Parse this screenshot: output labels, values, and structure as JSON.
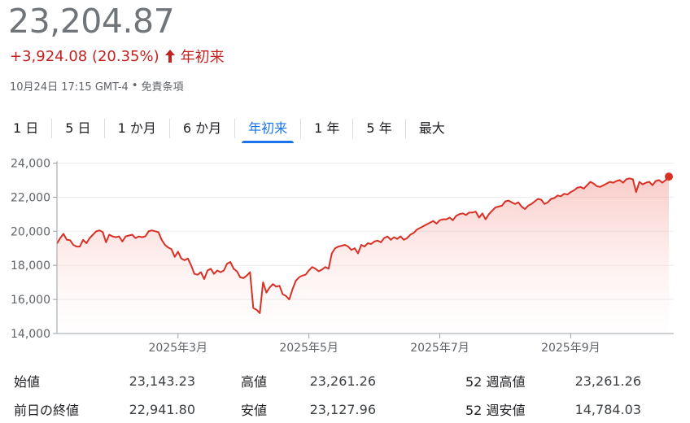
{
  "quote": {
    "price": "23,204.87",
    "change": "+3,924.08 (20.35%)",
    "period_label": "年初来",
    "timestamp": "10月24日 17:15 GMT-4",
    "disclaimer": "免責条項",
    "change_color": "#c5221f"
  },
  "tabs": [
    {
      "label": "1 日",
      "active": false
    },
    {
      "label": "5 日",
      "active": false
    },
    {
      "label": "1 か月",
      "active": false
    },
    {
      "label": "6 か月",
      "active": false
    },
    {
      "label": "年初来",
      "active": true
    },
    {
      "label": "1 年",
      "active": false
    },
    {
      "label": "5 年",
      "active": false
    },
    {
      "label": "最大",
      "active": false
    }
  ],
  "chart_data": {
    "type": "area",
    "x_tick_labels": [
      "2025年3月",
      "2025年5月",
      "2025年7月",
      "2025年9月"
    ],
    "x_tick_index": [
      37,
      77,
      117,
      157
    ],
    "y_ticks": [
      14000,
      16000,
      18000,
      20000,
      22000,
      24000
    ],
    "y_tick_labels": [
      "14,000",
      "16,000",
      "18,000",
      "20,000",
      "22,000",
      "24,000"
    ],
    "ylim": [
      14000,
      24500
    ],
    "grid": true,
    "line_color": "#d93025",
    "values": [
      19280,
      19600,
      19850,
      19500,
      19480,
      19200,
      19100,
      19100,
      19500,
      19300,
      19600,
      19800,
      20000,
      20050,
      19950,
      19350,
      19800,
      19700,
      19650,
      19700,
      19400,
      19700,
      19750,
      19800,
      19600,
      19700,
      19650,
      19700,
      20000,
      20050,
      20000,
      19950,
      19500,
      19200,
      19050,
      18950,
      18500,
      18800,
      18400,
      18300,
      18400,
      18000,
      17500,
      17450,
      17600,
      17200,
      17700,
      17800,
      17500,
      17700,
      17600,
      17700,
      18100,
      18200,
      17800,
      17650,
      17300,
      17250,
      17400,
      17600,
      15500,
      15400,
      15200,
      17000,
      16400,
      16700,
      16900,
      16750,
      16800,
      16300,
      16200,
      16000,
      16600,
      17100,
      17300,
      17400,
      17450,
      17700,
      17900,
      17800,
      17650,
      17750,
      17900,
      17800,
      18700,
      19000,
      19100,
      19150,
      19200,
      19100,
      18900,
      19000,
      18700,
      19200,
      19100,
      19300,
      19250,
      19400,
      19450,
      19350,
      19600,
      19700,
      19500,
      19650,
      19550,
      19700,
      19500,
      19600,
      19800,
      19900,
      20100,
      20200,
      20300,
      20400,
      20500,
      20600,
      20450,
      20650,
      20700,
      20700,
      20800,
      20650,
      20900,
      21000,
      21050,
      20950,
      21100,
      21100,
      21150,
      20800,
      21050,
      20700,
      21000,
      21200,
      21400,
      21450,
      21500,
      21750,
      21800,
      21700,
      21600,
      21700,
      21450,
      21300,
      21500,
      21600,
      21750,
      21900,
      21850,
      21600,
      21700,
      21900,
      21950,
      22100,
      22050,
      22200,
      22150,
      22300,
      22400,
      22550,
      22600,
      22500,
      22700,
      22900,
      22800,
      22650,
      22600,
      22700,
      22800,
      22900,
      22850,
      22950,
      23000,
      22850,
      23050,
      23100,
      23050,
      22300,
      22900,
      22750,
      22850,
      22900,
      22700,
      22950,
      23000,
      22850,
      23000,
      23205
    ]
  },
  "stats": [
    {
      "label": "始値",
      "value": "23,143.23"
    },
    {
      "label": "高値",
      "value": "23,261.26"
    },
    {
      "label": "52 週高値",
      "value": "23,261.26"
    },
    {
      "label": "前日の終値",
      "value": "22,941.80"
    },
    {
      "label": "安値",
      "value": "23,127.96"
    },
    {
      "label": "52 週安値",
      "value": "14,784.03"
    }
  ]
}
